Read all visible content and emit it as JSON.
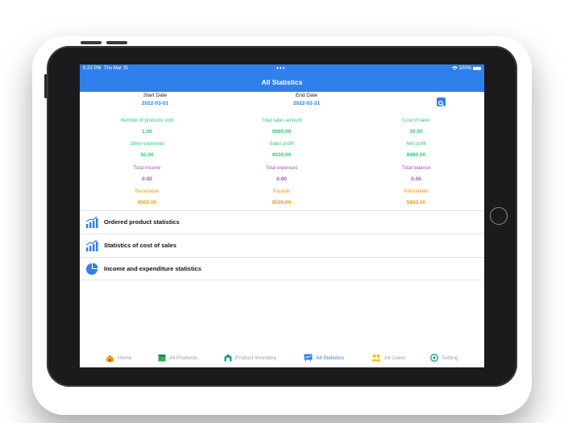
{
  "status_bar": {
    "time": "6:23 PM",
    "date": "Thu Mar 31",
    "battery": "100%"
  },
  "nav": {
    "title": "All Statistics"
  },
  "dates": {
    "start_label": "Start Date",
    "start_value": "2022-03-01",
    "end_label": "End Date",
    "end_value": "2022-03-31"
  },
  "search_icon": "search-icon",
  "stats": [
    {
      "label": "Number of products sold",
      "value": "1.00",
      "color": "#2ecc71"
    },
    {
      "label": "Total sales amount",
      "value": "9060.00",
      "color": "#2ecc71"
    },
    {
      "label": "Cost of sales",
      "value": "30.00",
      "color": "#2ecc71"
    },
    {
      "label": "Other expenses",
      "value": "50.00",
      "color": "#2ecc71"
    },
    {
      "label": "Sales profit",
      "value": "9030.00",
      "color": "#2ecc71"
    },
    {
      "label": "Net profit",
      "value": "8980.00",
      "color": "#2ecc71"
    },
    {
      "label": "Total income",
      "value": "0.00",
      "color": "#9b59b6"
    },
    {
      "label": "Total expenses",
      "value": "0.00",
      "color": "#9b59b6"
    },
    {
      "label": "Total balance",
      "value": "0.00",
      "color": "#9b59b6"
    },
    {
      "label": "Receivable",
      "value": "9060.00",
      "color": "#f39c12"
    },
    {
      "label": "Payable",
      "value": "8530.00",
      "color": "#f39c12"
    },
    {
      "label": "Refundable",
      "value": "5850.00",
      "color": "#f39c12"
    }
  ],
  "list": [
    {
      "label": "Ordered product statistics",
      "icon": "bar-chart-icon"
    },
    {
      "label": "Statistics of cost of sales",
      "icon": "bar-chart-icon"
    },
    {
      "label": "Income and expenditure statistics",
      "icon": "pie-chart-icon"
    }
  ],
  "tabs": [
    {
      "label": "Home",
      "icon": "home-icon"
    },
    {
      "label": "All Products",
      "icon": "products-icon"
    },
    {
      "label": "Product Inventory",
      "icon": "inventory-icon"
    },
    {
      "label": "All Statistics",
      "icon": "statistics-icon",
      "active": true
    },
    {
      "label": "All Users",
      "icon": "users-icon"
    },
    {
      "label": "Setting",
      "icon": "settings-icon"
    }
  ],
  "colors": {
    "accent": "#2f80ed",
    "green": "#2ecc71",
    "purple": "#9b59b6",
    "orange": "#f39c12"
  }
}
